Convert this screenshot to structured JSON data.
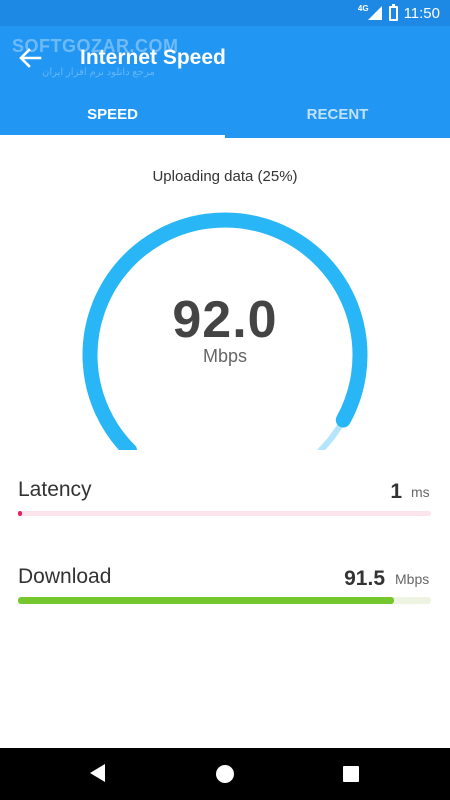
{
  "status_bar": {
    "network": "4G",
    "time": "11:50"
  },
  "watermark": {
    "text": "SOFTGOZAR.COM",
    "sub": "مرجع دانلود نرم افزار ایران"
  },
  "app_bar": {
    "title": "Internet Speed",
    "back_icon": "arrow-back-icon"
  },
  "tabs": [
    {
      "label": "SPEED",
      "active": true
    },
    {
      "label": "RECENT",
      "active": false
    }
  ],
  "test": {
    "status": "Uploading data (25%)",
    "upload_progress_fraction": 0.25
  },
  "gauge": {
    "value": "92.0",
    "unit": "Mbps",
    "fill_fraction": 0.94,
    "color": "#29b6f6",
    "track_color": "#b3e5fc"
  },
  "metrics": {
    "latency": {
      "label": "Latency",
      "value": "1",
      "unit": "ms",
      "fraction": 0.01,
      "fill_color": "#e91e63",
      "track_color": "#fce4ec"
    },
    "download": {
      "label": "Download",
      "value": "91.5",
      "unit": "Mbps",
      "fraction": 0.91,
      "fill_color": "#76c72e",
      "track_color": "#eef3e2"
    }
  },
  "colors": {
    "primary": "#2196f3",
    "primary_dark": "#1e88e5"
  },
  "nav_bar": {
    "icons": [
      "nav-back-icon",
      "nav-home-icon",
      "nav-recents-icon"
    ]
  }
}
